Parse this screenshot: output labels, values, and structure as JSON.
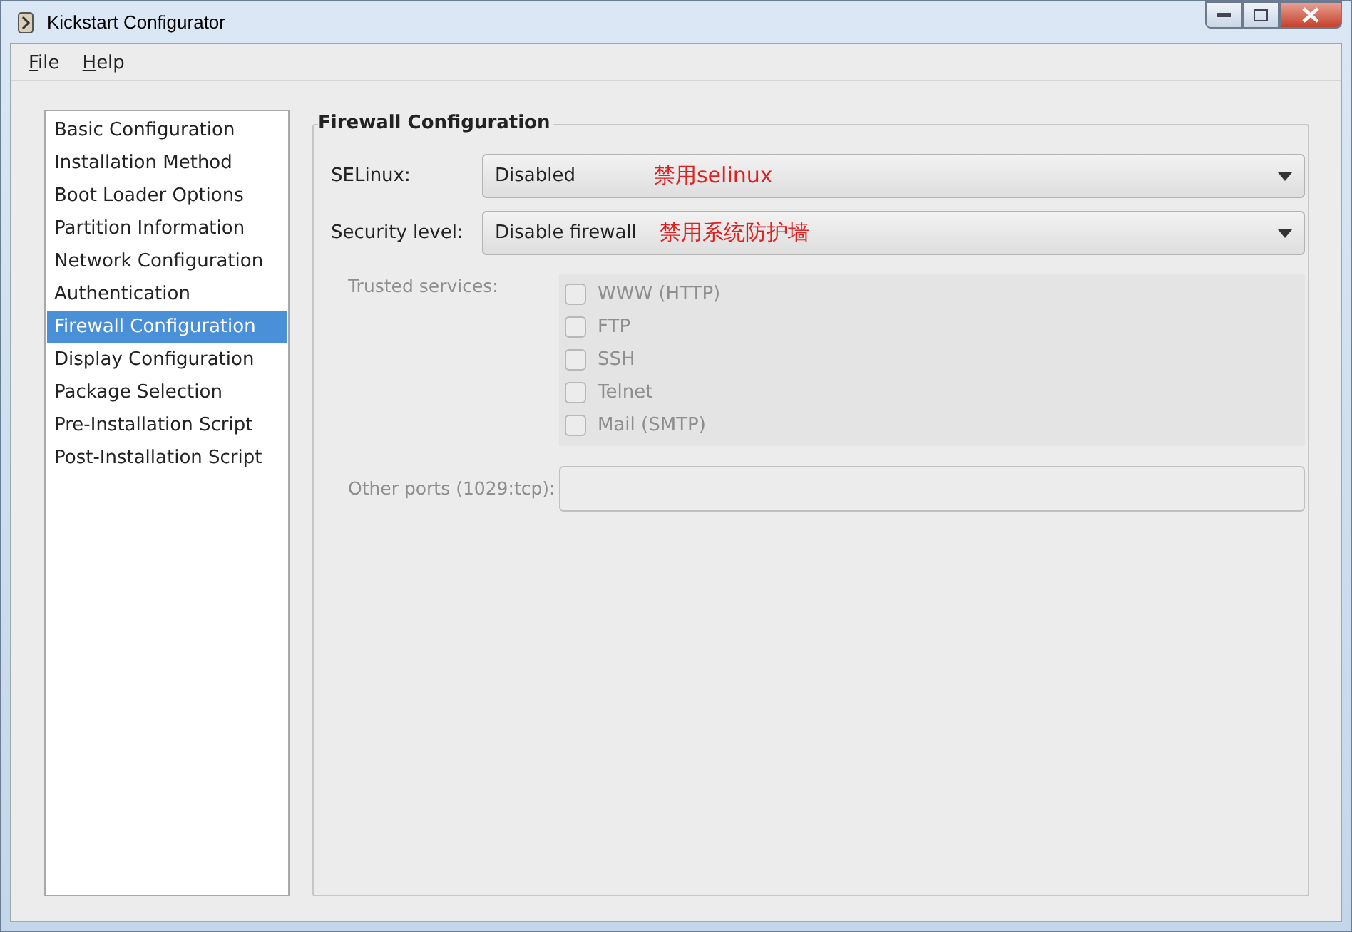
{
  "window": {
    "title": "Kickstart Configurator"
  },
  "menu": [
    {
      "label": "File"
    },
    {
      "label": "Help"
    }
  ],
  "sidebar": {
    "items": [
      {
        "label": "Basic Configuration",
        "selected": false
      },
      {
        "label": "Installation Method",
        "selected": false
      },
      {
        "label": "Boot Loader Options",
        "selected": false
      },
      {
        "label": "Partition Information",
        "selected": false
      },
      {
        "label": "Network Configuration",
        "selected": false
      },
      {
        "label": "Authentication",
        "selected": false
      },
      {
        "label": "Firewall Configuration",
        "selected": true
      },
      {
        "label": "Display Configuration",
        "selected": false
      },
      {
        "label": "Package Selection",
        "selected": false
      },
      {
        "label": "Pre-Installation Script",
        "selected": false
      },
      {
        "label": "Post-Installation Script",
        "selected": false
      }
    ]
  },
  "frame": {
    "title": "Firewall Configuration",
    "selects": [
      {
        "label": "SELinux:",
        "value": "Disabled",
        "annotation": "禁用selinux"
      },
      {
        "label": "Security level:",
        "value": "Disable firewall",
        "annotation": "禁用系统防护墙"
      }
    ],
    "trusted_services": {
      "label": "Trusted services:",
      "disabled": true,
      "items": [
        {
          "label": "WWW (HTTP)",
          "checked": false
        },
        {
          "label": "FTP",
          "checked": false
        },
        {
          "label": "SSH",
          "checked": false
        },
        {
          "label": "Telnet",
          "checked": false
        },
        {
          "label": "Mail (SMTP)",
          "checked": false
        }
      ]
    },
    "other_ports": {
      "label": "Other ports (1029:tcp):",
      "disabled": true
    }
  }
}
